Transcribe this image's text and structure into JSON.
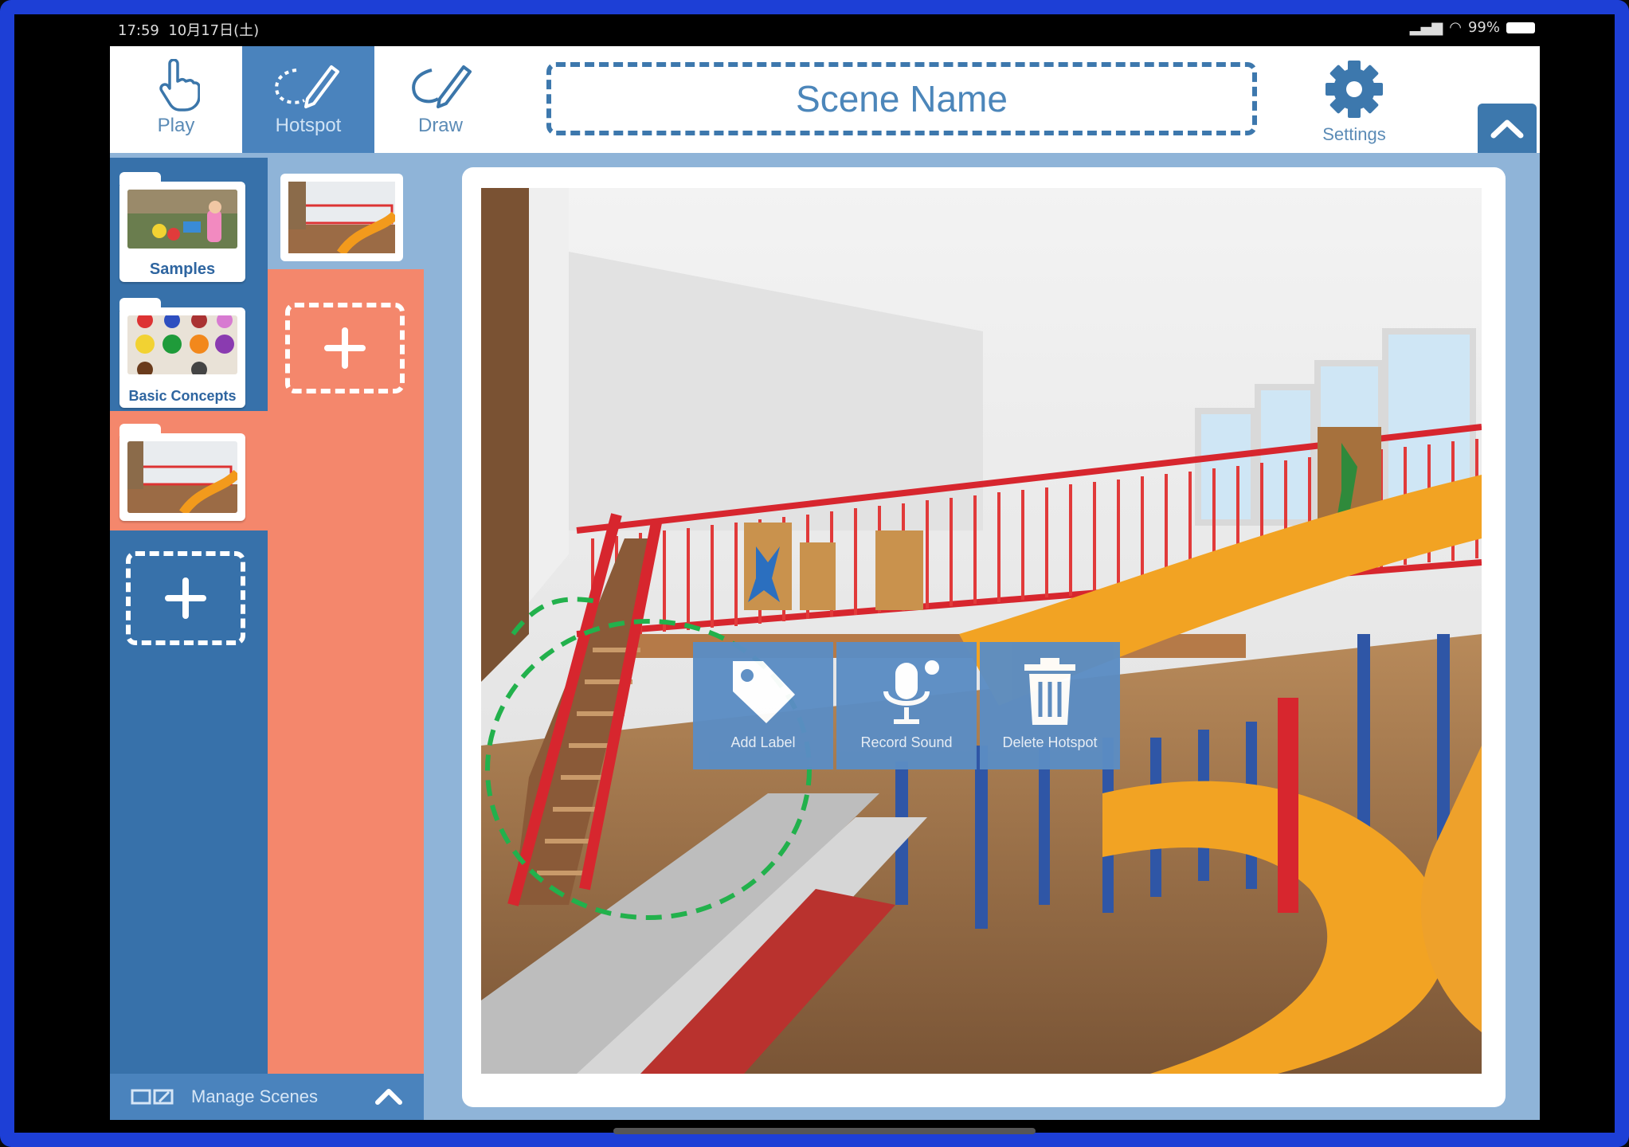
{
  "status_bar": {
    "time": "17:59",
    "date": "10月17日(土)",
    "battery": "99%"
  },
  "toolbar": {
    "tools": [
      {
        "label": "Play",
        "icon": "hand-pointer-icon",
        "active": false
      },
      {
        "label": "Hotspot",
        "icon": "lasso-pencil-icon",
        "active": true
      },
      {
        "label": "Draw",
        "icon": "pencil-draw-icon",
        "active": false
      }
    ],
    "scene_name_placeholder": "Scene Name",
    "settings_label": "Settings"
  },
  "folders": {
    "items": [
      {
        "label": "Samples",
        "icon": "folder-icon"
      },
      {
        "label": "Basic Concepts",
        "icon": "folder-icon"
      },
      {
        "label": "",
        "icon": "folder-icon",
        "active": true
      }
    ]
  },
  "hotspot_menu": {
    "items": [
      {
        "label": "Add Label",
        "icon": "tag-icon"
      },
      {
        "label": "Record Sound",
        "icon": "microphone-icon"
      },
      {
        "label": "Delete Hotspot",
        "icon": "trash-icon"
      }
    ]
  },
  "footer": {
    "manage_label": "Manage Scenes"
  },
  "colors": {
    "accent_blue": "#3d78ad",
    "sidebar_blue": "#3771aa",
    "salmon": "#f4876c",
    "hotspot_green": "#22b14c",
    "frame_blue": "#1d3fd6"
  }
}
